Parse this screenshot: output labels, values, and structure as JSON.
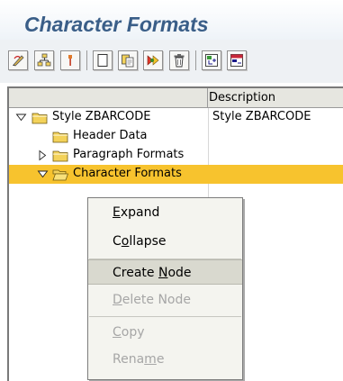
{
  "page": {
    "title": "Character Formats"
  },
  "toolbar": {
    "buttons": [
      {
        "icon": "edit-pencil-icon"
      },
      {
        "icon": "hierarchy-icon"
      },
      {
        "icon": "pin-icon"
      },
      {
        "icon": "new-document-icon"
      },
      {
        "icon": "copy-document-icon"
      },
      {
        "icon": "create-object-icon"
      },
      {
        "icon": "trash-icon"
      },
      {
        "icon": "expand-subtree-icon"
      },
      {
        "icon": "collapse-subtree-icon"
      }
    ]
  },
  "tree": {
    "columns": [
      "",
      "Description"
    ],
    "rows": [
      {
        "label": "Style ZBARCODE",
        "description": "Style ZBARCODE",
        "expanded": true,
        "level": 0
      },
      {
        "label": "Header Data",
        "description": "",
        "expanded": null,
        "level": 1
      },
      {
        "label": "Paragraph Formats",
        "description": "",
        "expanded": false,
        "level": 1
      },
      {
        "label": "Character Formats",
        "description": "",
        "expanded": true,
        "level": 1,
        "selected": true
      }
    ]
  },
  "context_menu": {
    "items": [
      {
        "pre": "",
        "key": "E",
        "post": "xpand",
        "enabled": true
      },
      {
        "pre": "C",
        "key": "o",
        "post": "llapse",
        "enabled": true
      },
      {
        "pre": "Create ",
        "key": "N",
        "post": "ode",
        "enabled": true,
        "highlighted": true
      },
      {
        "pre": "",
        "key": "D",
        "post": "elete Node",
        "enabled": false
      },
      {
        "pre": "",
        "key": "C",
        "post": "opy",
        "enabled": false
      },
      {
        "pre": "Rena",
        "key": "m",
        "post": "e",
        "enabled": false
      }
    ]
  },
  "colors": {
    "title": "#3a5e88",
    "selection": "#f7c32e",
    "menu_highlight": "#d9d9cf",
    "folder": "#f3d25a"
  }
}
